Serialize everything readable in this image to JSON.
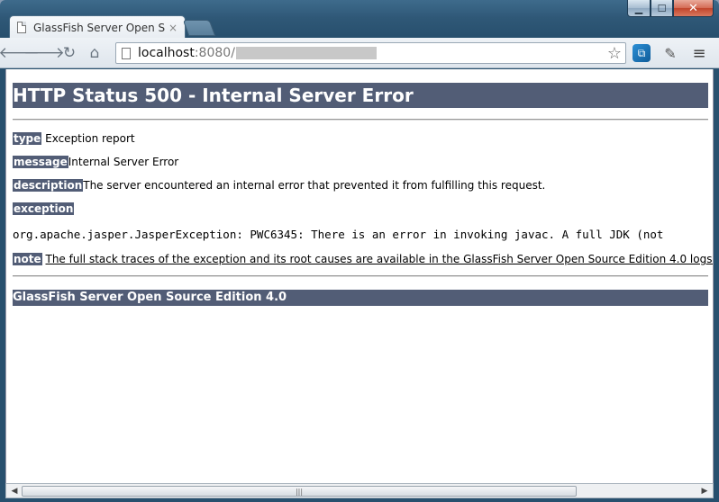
{
  "window": {
    "controls": {
      "minimize": "▁",
      "maximize": "☐",
      "close": "✕"
    }
  },
  "tab": {
    "title": "GlassFish Server Open Sou",
    "close": "×"
  },
  "toolbar": {
    "back": "🡐",
    "forward": "🡒",
    "reload": "↻",
    "home": "⌂",
    "url_host": "localhost",
    "url_port": ":8080/",
    "star": "☆",
    "ext1": "⧉",
    "ext2": "✎",
    "menu": "≡"
  },
  "page": {
    "heading": "HTTP Status 500 - Internal Server Error",
    "type_label": "type",
    "type_value": " Exception report",
    "message_label": "message",
    "message_value": "Internal Server Error",
    "description_label": "description",
    "description_value": "The server encountered an internal error that prevented it from fulfilling this request.",
    "exception_label": "exception",
    "exception_value": "org.apache.jasper.JasperException: PWC6345: There is an error in invoking javac.  A full JDK (not",
    "note_label": "note",
    "note_value": "The full stack traces of the exception and its root causes are available in the GlassFish Server Open Source Edition 4.0 logs.",
    "footer": "GlassFish Server Open Source Edition 4.0"
  },
  "scrollbar": {
    "left": "◀",
    "right": "▶",
    "grip": "|||"
  }
}
